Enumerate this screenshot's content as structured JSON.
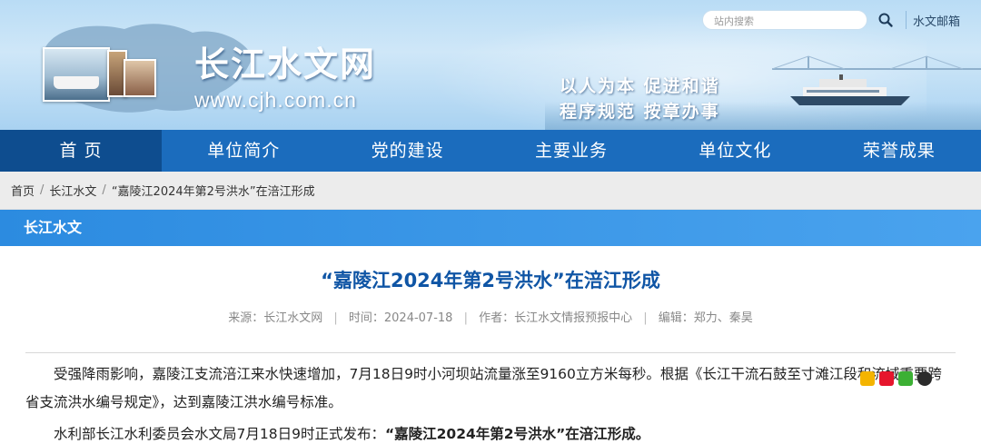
{
  "site": {
    "name": "长江水文网",
    "url": "www.cjh.com.cn",
    "slogan_line1": "以人为本  促进和谐",
    "slogan_line2": "程序规范  按章办事"
  },
  "search": {
    "placeholder": "站内搜索"
  },
  "top_links": {
    "mail": "水文邮箱"
  },
  "nav": {
    "items": [
      {
        "label": "首  页"
      },
      {
        "label": "单位简介"
      },
      {
        "label": "党的建设"
      },
      {
        "label": "主要业务"
      },
      {
        "label": "单位文化"
      },
      {
        "label": "荣誉成果"
      }
    ]
  },
  "breadcrumb": {
    "items": [
      "首页",
      "长江水文",
      "“嘉陵江2024年第2号洪水”在涪江形成"
    ],
    "separator": "/"
  },
  "section": {
    "title": "长江水文"
  },
  "article": {
    "title": "“嘉陵江2024年第2号洪水”在涪江形成",
    "source": "来源：长江水文网",
    "time": "时间：2024-07-18",
    "author": "作者：长江水文情报预报中心",
    "editor": "编辑：郑力、秦昊",
    "para1": "受强降雨影响，嘉陵江支流涪江来水快速增加，7月18日9时小河坝站流量涨至9160立方米每秒。根据《长江干流石鼓至寸滩江段和流域重要跨省支流洪水编号规定》，达到嘉陵江洪水编号标准。",
    "para2_prefix": "水利部长江水利委员会水文局7月18日9时正式发布：",
    "para2_bold": "“嘉陵江2024年第2号洪水”在涪江形成。"
  },
  "colors": {
    "nav_bg": "#1b6cbd",
    "nav_active": "#0e4d8f",
    "section_bar": "#2c8be0",
    "title": "#0f55a5"
  }
}
